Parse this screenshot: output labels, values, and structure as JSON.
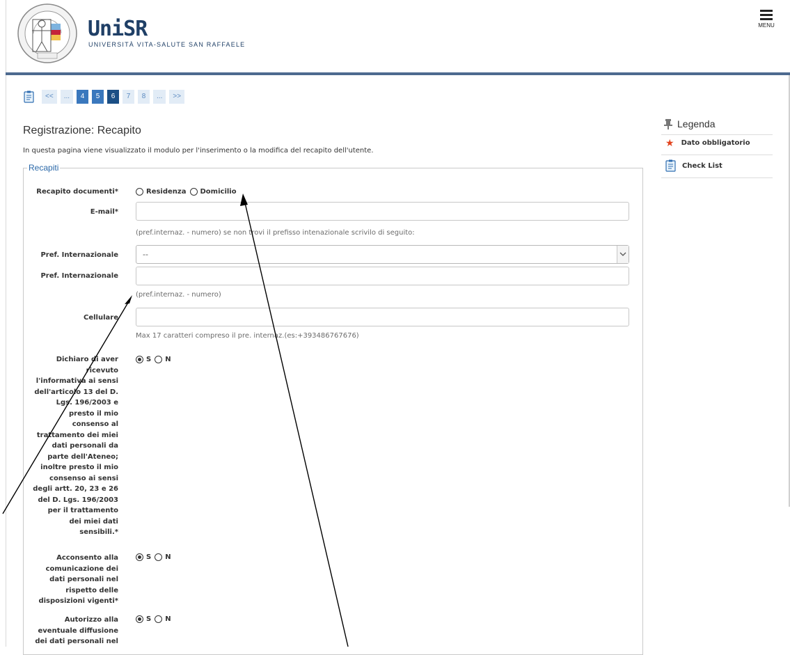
{
  "header": {
    "brand_name": "UniSR",
    "brand_subtitle": "UNIVERSITÀ VITA-SALUTE SAN RAFFAELE",
    "seal_text": "UNIVERSITÀ VITA-SALUTE SAN RAFFAELE",
    "menu_label": "MENU"
  },
  "pagination": {
    "items": [
      {
        "label": "<<",
        "style": "light"
      },
      {
        "label": "...",
        "style": "light"
      },
      {
        "label": "4",
        "style": "mid"
      },
      {
        "label": "5",
        "style": "mid"
      },
      {
        "label": "6",
        "style": "dark"
      },
      {
        "label": "7",
        "style": "light"
      },
      {
        "label": "8",
        "style": "light"
      },
      {
        "label": "...",
        "style": "light"
      },
      {
        "label": ">>",
        "style": "light"
      }
    ],
    "current_page": "6"
  },
  "page": {
    "title": "Registrazione: Recapito",
    "description": "In questa pagina viene visualizzato il modulo per l'inserimento o la modifica del recapito dell'utente."
  },
  "form": {
    "legend": "Recapiti",
    "recapito_documenti": {
      "label": "Recapito documenti*",
      "options": [
        "Residenza",
        "Domicilio"
      ],
      "selected": null
    },
    "email": {
      "label": "E-mail*",
      "value": ""
    },
    "pref_hint": "(pref.internaz. - numero) se non trovi il prefisso intenazionale scrivilo di seguito:",
    "pref_select": {
      "label": "Pref. Internazionale",
      "value": "--"
    },
    "pref_input": {
      "label": "Pref. Internazionale",
      "value": "",
      "hint": "(pref.internaz. - numero)"
    },
    "cellulare": {
      "label": "Cellulare",
      "value": "",
      "hint": "Max 17 caratteri compreso il pre. internaz.(es:+393486767676)"
    },
    "consenso_informativa": {
      "label_lines": [
        "Dichiaro di aver",
        "ricevuto",
        "l'informativa ai sensi",
        "dell'articolo 13 del D.",
        "Lgs. 196/2003 e",
        "presto il mio",
        "consenso al",
        "trattamento dei miei",
        "dati personali da",
        "parte dell'Ateneo;",
        "inoltre presto il mio",
        "consenso ai sensi",
        "degli artt. 20, 23 e 26",
        "del D. Lgs. 196/2003",
        "per il trattamento",
        "dei miei dati",
        "sensibili.*"
      ],
      "options": [
        "S",
        "N"
      ],
      "selected": "S"
    },
    "consenso_comunicazione": {
      "label_lines": [
        "Acconsento alla",
        "comunicazione dei",
        "dati personali nel",
        "rispetto delle",
        "disposizioni vigenti*"
      ],
      "options": [
        "S",
        "N"
      ],
      "selected": "S"
    },
    "consenso_diffusione": {
      "label_lines": [
        "Autorizzo alla",
        "eventuale diffusione",
        "dei dati personali nel"
      ],
      "options": [
        "S",
        "N"
      ],
      "selected": "S"
    }
  },
  "legenda": {
    "title": "Legenda",
    "items": [
      {
        "icon": "star-icon",
        "label": "Dato obbligatorio"
      },
      {
        "icon": "checklist-icon",
        "label": "Check List"
      }
    ]
  },
  "colors": {
    "header_rule": "#4d6a8f",
    "pager_current": "#1b4f85",
    "pager_active": "#3a78bd",
    "pager_light": "#e2ecf6",
    "legend_blue": "#2a68a8",
    "required_star": "#e2431d"
  }
}
